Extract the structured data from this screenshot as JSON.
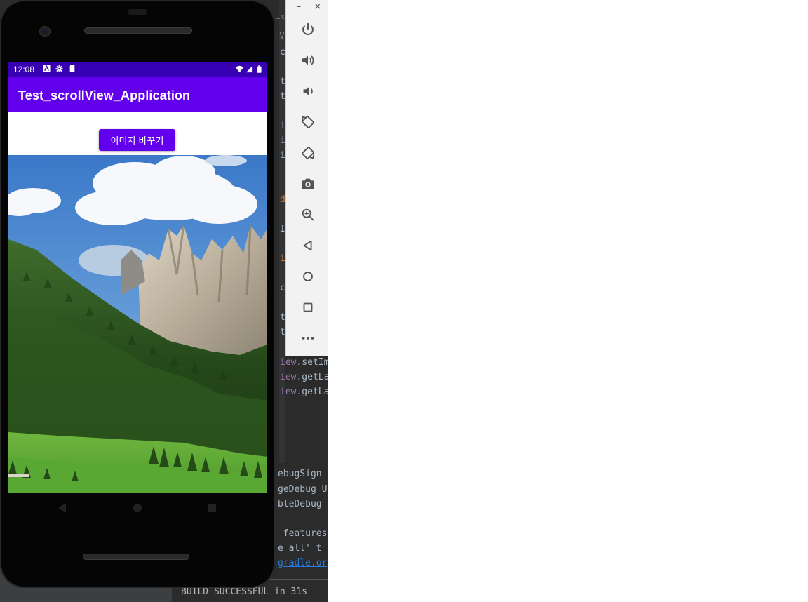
{
  "ide": {
    "code_fragments": [
      "ix",
      "V",
      "c",
      "t",
      "t",
      "i",
      "i",
      "i",
      "d",
      "I",
      "i",
      "c",
      "t",
      "t"
    ],
    "code_lines": [
      {
        "kw": "iew",
        "rest": ".setIm"
      },
      {
        "kw": "iew",
        "rest": ".getLa"
      },
      {
        "kw": "iew",
        "rest": ".getLa"
      }
    ],
    "build_lines": [
      "ebugSign",
      "geDebug U",
      "bleDebug",
      "",
      " features",
      "e all' t"
    ],
    "build_link": "gradle.or",
    "status": "BUILD SUCCESSFUL in 31s"
  },
  "emulator_toolbar": {
    "window_controls": [
      "–",
      "×"
    ],
    "buttons": [
      "power-icon",
      "volume-up-icon",
      "volume-down-icon",
      "rotate-left-icon",
      "rotate-right-icon",
      "camera-icon",
      "zoom-icon",
      "back-icon",
      "home-icon",
      "overview-icon",
      "more-icon"
    ]
  },
  "status_bar": {
    "time": "12:08",
    "left_icons": [
      "a-icon",
      "gear-icon",
      "sd-card-icon"
    ],
    "right_icons": [
      "wifi-icon",
      "signal-icon",
      "battery-icon"
    ]
  },
  "app": {
    "title": "Test_scrollView_Application",
    "change_button_label": "이미지 바꾸기",
    "accent": "#6200ee",
    "status_color": "#3700b3"
  },
  "nav": [
    "back-icon",
    "home-icon",
    "recents-icon"
  ]
}
